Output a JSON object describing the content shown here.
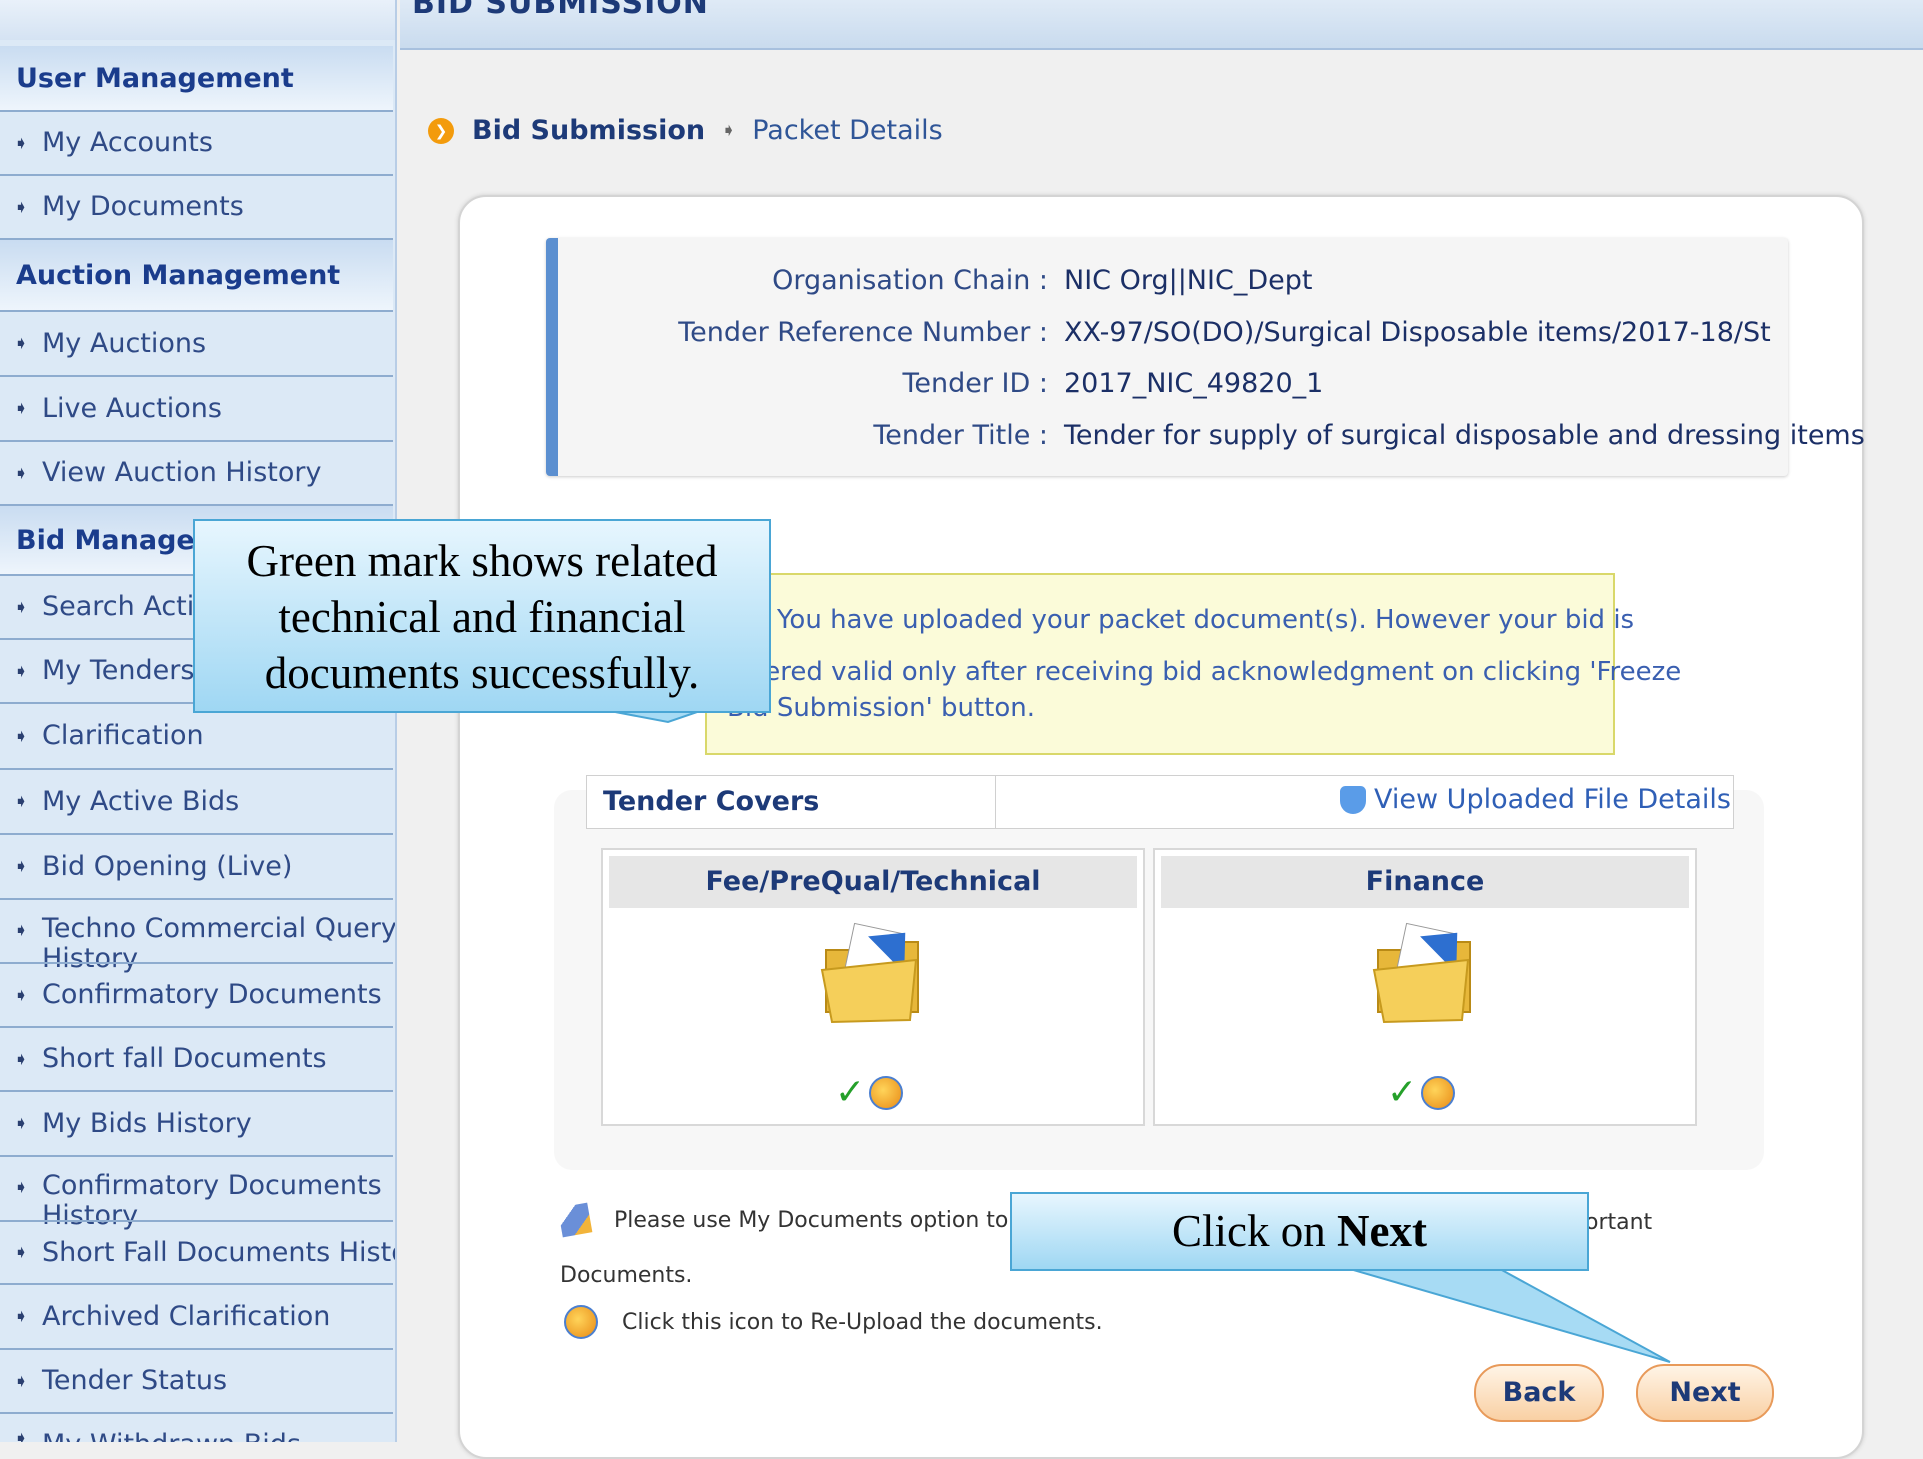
{
  "page": {
    "section_title": "BID SUBMISSION"
  },
  "sidebar": {
    "groups": [
      {
        "label": "User Management"
      },
      {
        "label": "Auction Management"
      },
      {
        "label": "Bid Managemer"
      }
    ],
    "items": [
      "My Accounts",
      "My Documents",
      "My Auctions",
      "Live Auctions",
      "View Auction History",
      "Search Active",
      "My Tenders",
      "Clarification",
      "My Active Bids",
      "Bid Opening (Live)",
      "Techno Commercial Query",
      "History",
      "Confirmatory Documents",
      "Short fall Documents",
      "My Bids History",
      "Confirmatory Documents",
      "History",
      "Short Fall Documents History",
      "Archived Clarification",
      "Tender Status",
      "My Withdrawn Bids"
    ]
  },
  "breadcrumb": {
    "current": "Bid Submission",
    "next": "Packet Details"
  },
  "tender_info": {
    "rows": [
      {
        "label": "Organisation Chain :",
        "value": "NIC Org||NIC_Dept"
      },
      {
        "label": "Tender Reference Number :",
        "value": "XX-97/SO(DO)/Surgical Disposable items/2017-18/St"
      },
      {
        "label": "Tender ID :",
        "value": "2017_NIC_49820_1"
      },
      {
        "label": "Tender Title :",
        "value": "Tender for supply of surgical disposable and dressing items"
      }
    ]
  },
  "warning": {
    "line1": "You have uploaded your packet document(s). However your bid is",
    "line2": "sidered valid only after receiving bid acknowledgment on clicking 'Freeze",
    "line3": "Bid Submission' button."
  },
  "covers": {
    "title": "Tender Covers",
    "view_link": "View Uploaded File Details",
    "items": [
      {
        "title": "Fee/PreQual/Technical"
      },
      {
        "title": "Finance"
      }
    ],
    "check_mark": "✓"
  },
  "notes": {
    "note1_start": "Please use My Documents option to up",
    "note1_end": "ortant",
    "note1_cont": "Documents.",
    "note2": "Click this icon to Re-Upload the documents."
  },
  "buttons": {
    "back": "Back",
    "next": "Next"
  },
  "callouts": {
    "green_mark": "Green mark shows related technical and financial documents successfully.",
    "click_prefix": "Click on ",
    "click_bold": "Next"
  },
  "colors": {
    "accent_orange": "#f39b0c",
    "check_green": "#25a02a",
    "callout_border": "#4aa6d5"
  }
}
